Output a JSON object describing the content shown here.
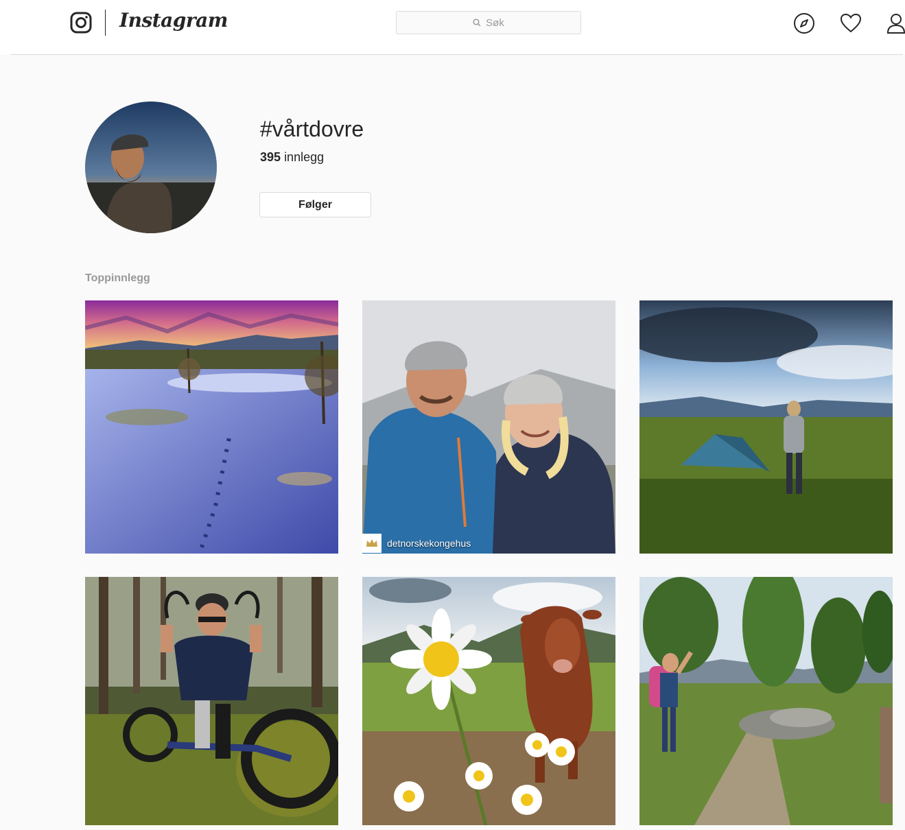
{
  "app": {
    "wordmark": "Instagram"
  },
  "header": {
    "search_placeholder": "Søk",
    "icons": [
      "instagram-glyph-icon",
      "search-icon",
      "compass-icon",
      "heart-icon",
      "profile-icon"
    ]
  },
  "profile": {
    "hashtag": "#vårtdovre",
    "post_count": "395",
    "post_count_label": "innlegg",
    "follow_button": "Følger"
  },
  "top_posts": {
    "label": "Toppinnlegg",
    "posts": [
      {
        "subject": "snowy-tundra-sunset"
      },
      {
        "subject": "couple-in-hats",
        "badge_text": "detnorskekongehus",
        "badge_icon": "crown-icon"
      },
      {
        "subject": "hiker-with-tent"
      },
      {
        "subject": "handbike-rider-in-forest"
      },
      {
        "subject": "cow-and-daisies"
      },
      {
        "subject": "hikers-on-trail"
      }
    ]
  },
  "colors": {
    "background": "#fafafa",
    "border": "#dbdbdb",
    "text": "#262626",
    "muted": "#999999"
  }
}
